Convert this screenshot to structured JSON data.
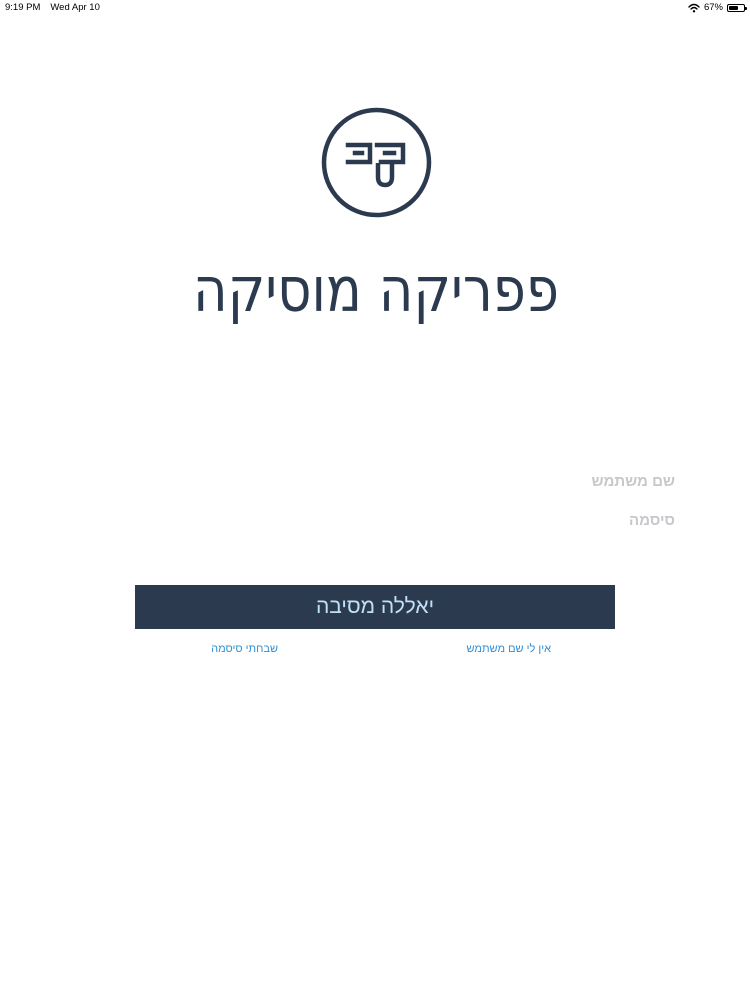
{
  "status_bar": {
    "time": "9:19 PM",
    "date": "Wed Apr 10",
    "battery_percent": "67%",
    "battery_level": 0.67,
    "icons": [
      "wifi-icon",
      "battery-icon"
    ]
  },
  "brand": {
    "logo_icon": "paprika-logo-icon",
    "wordmark": "פפריקה מוסיקה",
    "color": "#2b3a4f"
  },
  "login_form": {
    "username_placeholder": "שם משתמש",
    "username_value": "",
    "password_placeholder": "סיסמה",
    "password_value": "",
    "submit_label": "יאללה מסיבה",
    "submit_bg_color": "#2b3a4f",
    "submit_text_color": "#bfe1f5",
    "no_username_link": "אין לי שם משתמש",
    "forgot_password_link": "שבחתי סיסמה",
    "link_color": "#2f8fd6"
  }
}
